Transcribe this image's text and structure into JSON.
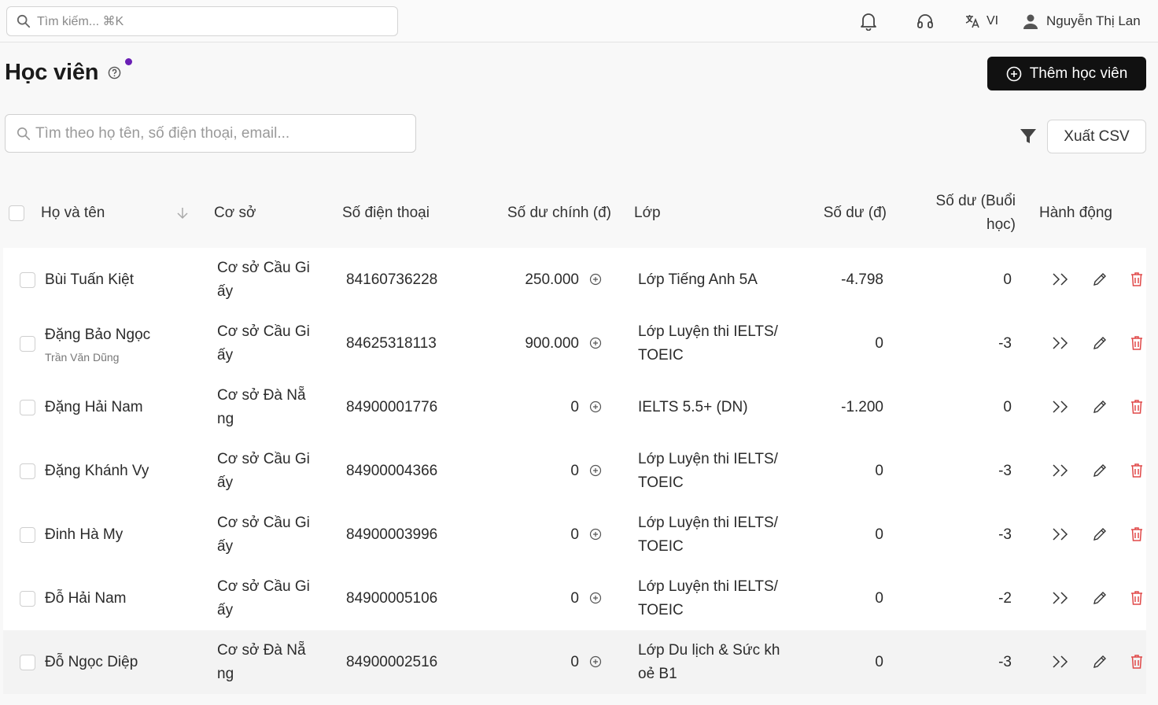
{
  "topbar": {
    "search_placeholder": "Tìm kiếm... ⌘K",
    "language": "VI",
    "user_name": "Nguyễn Thị Lan"
  },
  "page": {
    "title": "Học viên",
    "add_button": "Thêm học viên",
    "search_placeholder": "Tìm theo họ tên, số điện thoại, email...",
    "export_button": "Xuất CSV"
  },
  "table": {
    "columns": {
      "name": "Họ và tên",
      "branch": "Cơ sở",
      "phone": "Số điện thoại",
      "main_balance": "Số dư chính (đ)",
      "class": "Lớp",
      "balance": "Số dư (đ)",
      "session_balance": "Số dư (Buổi học)",
      "actions": "Hành động"
    },
    "rows": [
      {
        "name": "Bùi Tuấn Kiệt",
        "sub": "",
        "branch": "Cơ sở Cầu Giấy",
        "phone": "84160736228",
        "main_balance": "250.000",
        "class": "Lớp Tiếng Anh 5A",
        "balance": "-4.798",
        "sessions": "0"
      },
      {
        "name": "Đặng Bảo Ngọc",
        "sub": "Trần Văn Dũng",
        "branch": "Cơ sở Cầu Giấy",
        "phone": "84625318113",
        "main_balance": "900.000",
        "class": "Lớp Luyện thi IELTS/TOEIC",
        "balance": "0",
        "sessions": "-3"
      },
      {
        "name": "Đặng Hải Nam",
        "sub": "",
        "branch": "Cơ sở Đà Nẵng",
        "phone": "84900001776",
        "main_balance": "0",
        "class": "IELTS 5.5+ (DN)",
        "balance": "-1.200",
        "sessions": "0"
      },
      {
        "name": "Đặng Khánh Vy",
        "sub": "",
        "branch": "Cơ sở Cầu Giấy",
        "phone": "84900004366",
        "main_balance": "0",
        "class": "Lớp Luyện thi IELTS/TOEIC",
        "balance": "0",
        "sessions": "-3"
      },
      {
        "name": "Đinh Hà My",
        "sub": "",
        "branch": "Cơ sở Cầu Giấy",
        "phone": "84900003996",
        "main_balance": "0",
        "class": "Lớp Luyện thi IELTS/TOEIC",
        "balance": "0",
        "sessions": "-3"
      },
      {
        "name": "Đỗ Hải Nam",
        "sub": "",
        "branch": "Cơ sở Cầu Giấy",
        "phone": "84900005106",
        "main_balance": "0",
        "class": "Lớp Luyện thi IELTS/TOEIC",
        "balance": "0",
        "sessions": "-2"
      },
      {
        "name": "Đỗ Ngọc Diệp",
        "sub": "",
        "branch": "Cơ sở Đà Nẵng",
        "phone": "84900002516",
        "main_balance": "0",
        "class": "Lớp Du lịch & Sức khoẻ B1",
        "balance": "0",
        "sessions": "-3"
      }
    ]
  },
  "colors": {
    "primary_button": "#111111",
    "notification_dot": "#6a1fb5",
    "delete_icon": "#e04848"
  },
  "icons": [
    "search-icon",
    "bell-icon",
    "headset-icon",
    "translate-icon",
    "user-icon",
    "help-icon",
    "plus-circle-icon",
    "filter-icon",
    "sort-down-icon",
    "chevrons-right-icon",
    "pencil-icon",
    "trash-icon"
  ]
}
